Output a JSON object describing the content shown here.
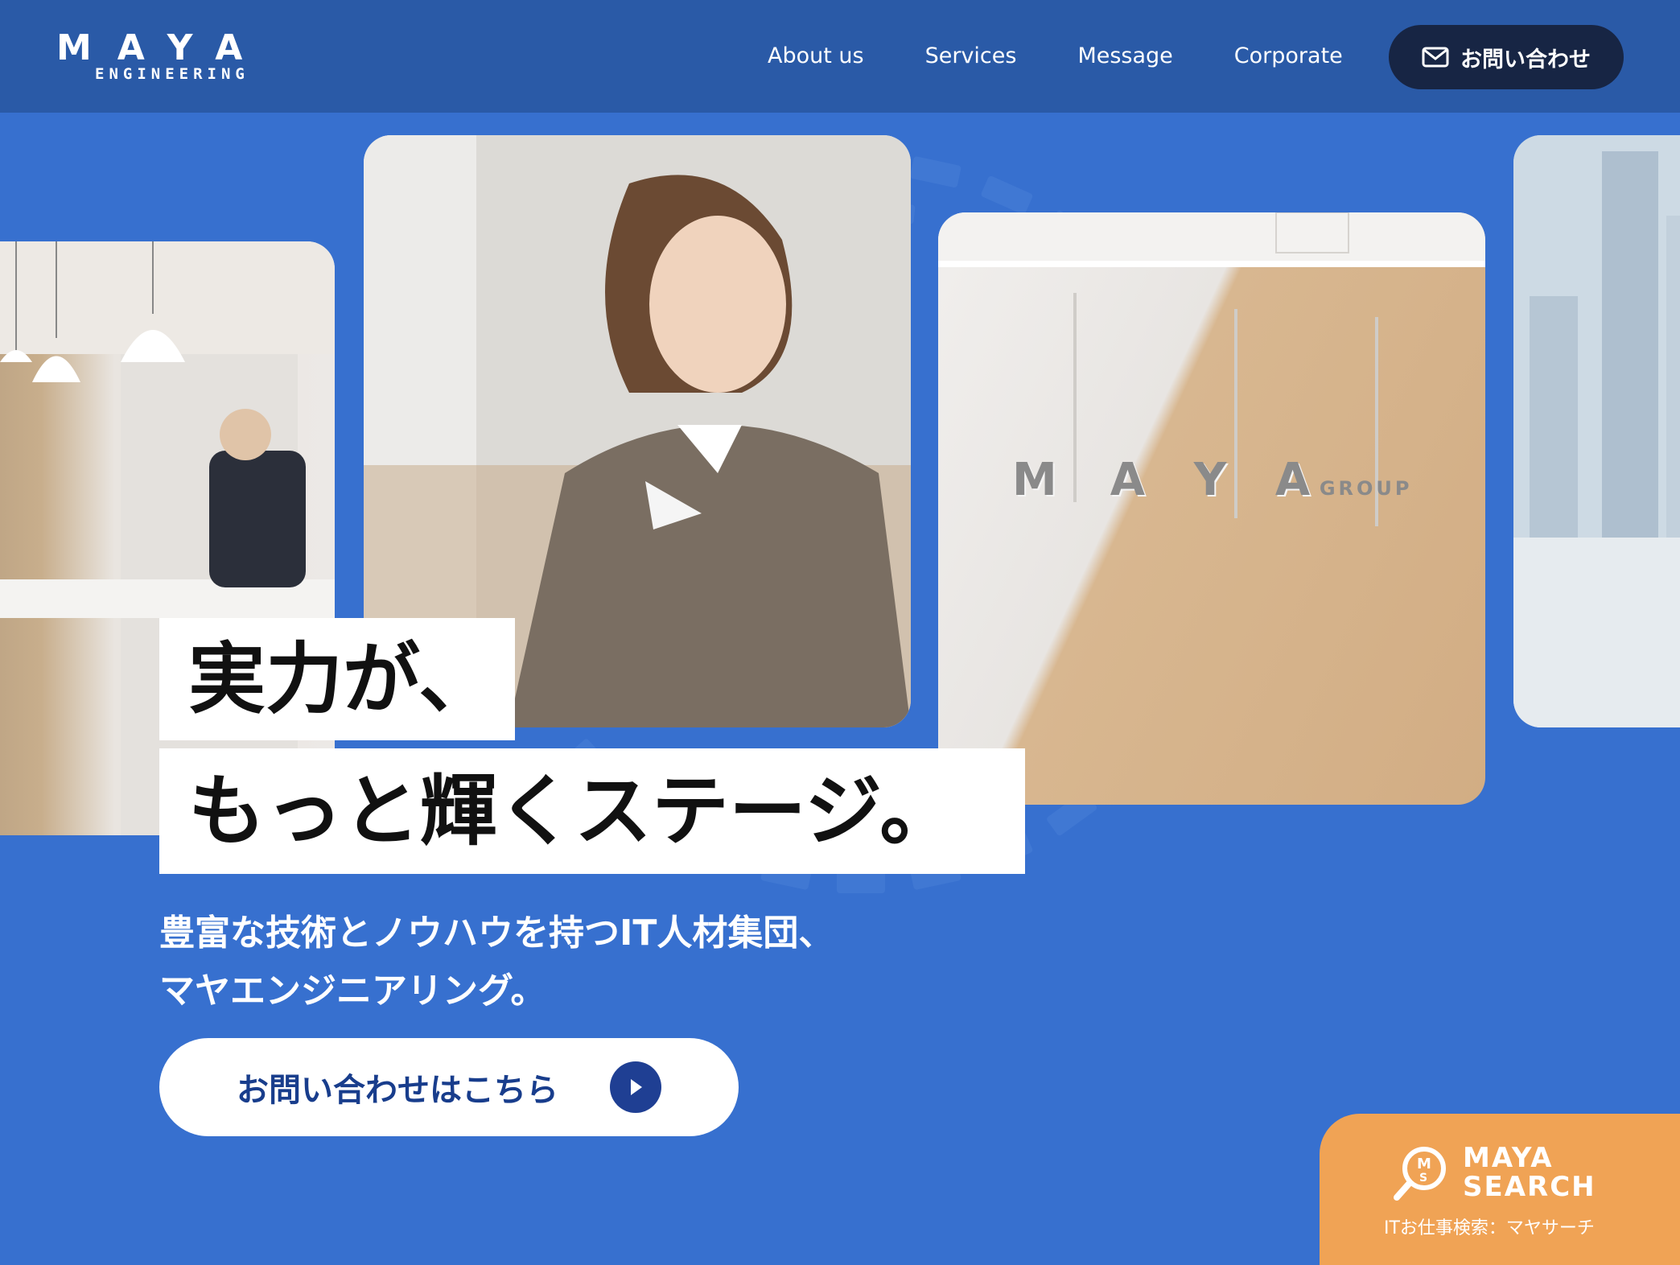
{
  "header": {
    "logo": {
      "word": "MAYA",
      "sub": "ENGINEERING"
    },
    "nav": [
      {
        "label": "About us"
      },
      {
        "label": "Services"
      },
      {
        "label": "Message"
      },
      {
        "label": "Corporate"
      }
    ],
    "contact_label": "お問い合わせ"
  },
  "hero": {
    "headline_line1": "実力が、",
    "headline_line2": "もっと輝くステージ。",
    "subcopy_line1": "豊富な技術とノウハウを持つIT人材集団、",
    "subcopy_line2": "マヤエンジニアリング。",
    "cta_label": "お問い合わせはこちら",
    "photos": [
      "office-lounge",
      "smiling-employee",
      "maya-group-lobby-sign",
      "city-window"
    ],
    "lobby_sign": {
      "word": "MAYA",
      "sub": "GROUP"
    }
  },
  "badge": {
    "title_line1": "MAYA",
    "title_line2": "SEARCH",
    "caption": "ITお仕事検索：マヤサーチ"
  },
  "colors": {
    "background": "#3770cf",
    "header": "#2a5aa7",
    "contact_button": "#172544",
    "cta_text": "#183d8c",
    "badge": "#f0a355"
  }
}
